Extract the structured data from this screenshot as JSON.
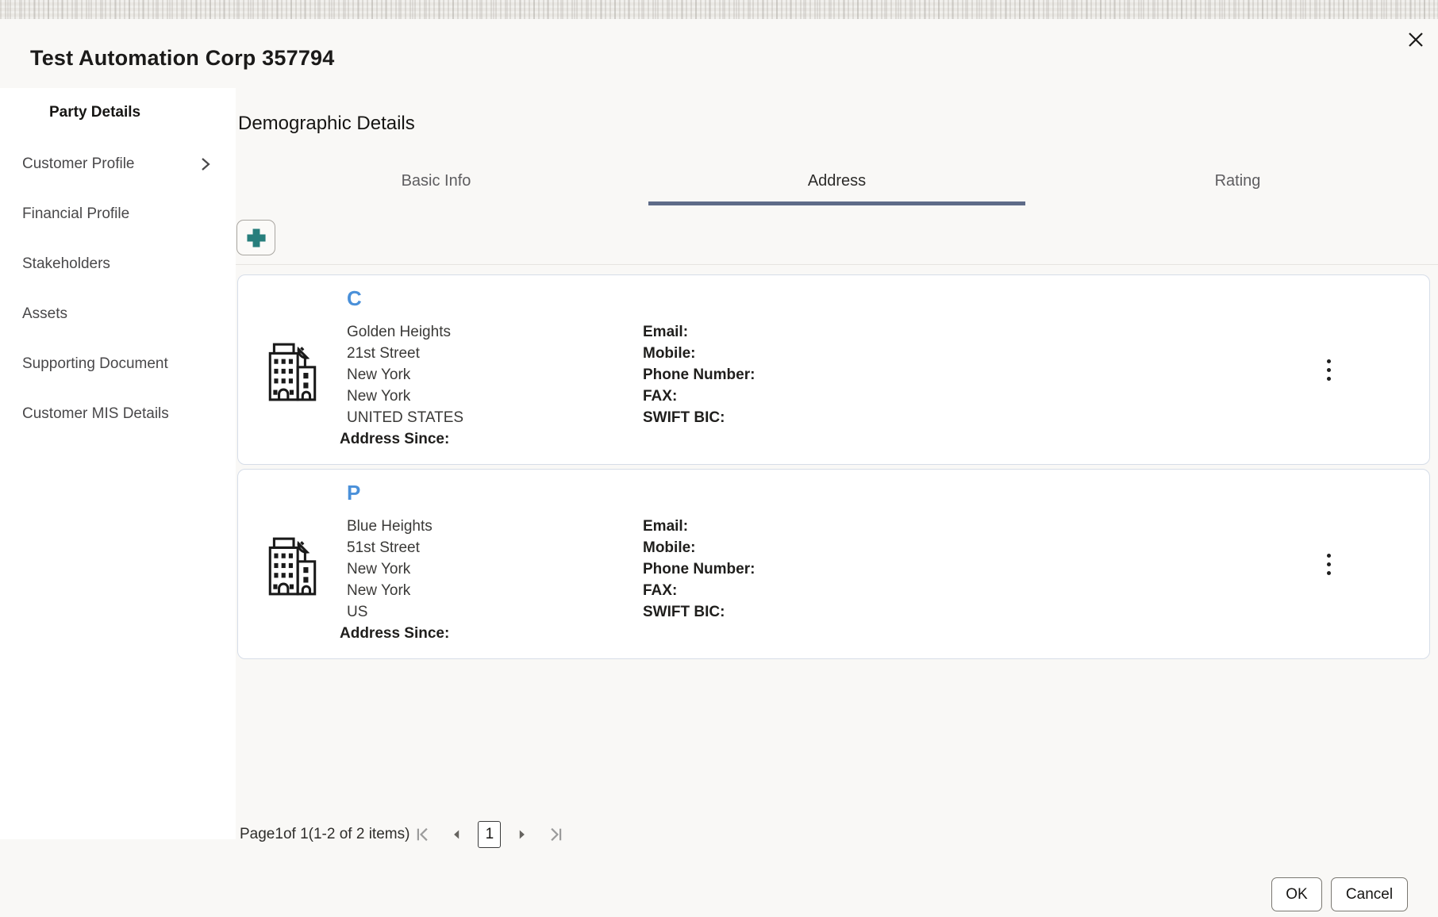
{
  "window": {
    "title": "Test Automation Corp 357794"
  },
  "sidebar": {
    "header": "Party Details",
    "items": [
      {
        "label": "Customer Profile",
        "has_submenu": true
      },
      {
        "label": "Financial Profile",
        "has_submenu": false
      },
      {
        "label": "Stakeholders",
        "has_submenu": false
      },
      {
        "label": "Assets",
        "has_submenu": false
      },
      {
        "label": "Supporting Document",
        "has_submenu": false
      },
      {
        "label": "Customer MIS Details",
        "has_submenu": false
      }
    ]
  },
  "main": {
    "heading": "Demographic Details",
    "tabs": [
      {
        "label": "Basic Info",
        "active": false
      },
      {
        "label": "Address",
        "active": true
      },
      {
        "label": "Rating",
        "active": false
      }
    ],
    "add_button": {
      "icon": "plus-icon"
    },
    "cards": [
      {
        "letter": "C",
        "icon": "building-icon",
        "address_lines": [
          "Golden Heights",
          "21st Street",
          "New York",
          "New York",
          "UNITED STATES"
        ],
        "address_since_label": "Address Since:",
        "contact_labels": [
          "Email:",
          "Mobile:",
          "Phone Number:",
          "FAX:",
          "SWIFT BIC:"
        ],
        "menu_icon": "kebab-menu-icon"
      },
      {
        "letter": "P",
        "icon": "building-icon",
        "address_lines": [
          "Blue Heights",
          "51st Street",
          "New York",
          "New York",
          "US"
        ],
        "address_since_label": "Address Since:",
        "contact_labels": [
          "Email:",
          "Mobile:",
          "Phone Number:",
          "FAX:",
          "SWIFT BIC:"
        ],
        "menu_icon": "kebab-menu-icon"
      }
    ],
    "pagination": {
      "page_label": "Page",
      "current_page": "1",
      "of_label": "of 1",
      "items_summary": "(1-2 of 2 items)",
      "page_box": "1"
    }
  },
  "footer": {
    "ok_label": "OK",
    "cancel_label": "Cancel"
  },
  "colors": {
    "accent_teal": "#277e7c",
    "link_blue": "#4a90d9",
    "tab_underline": "#5e6b88",
    "card_border": "#d6dde8",
    "modal_bg": "#f9f8f6"
  }
}
